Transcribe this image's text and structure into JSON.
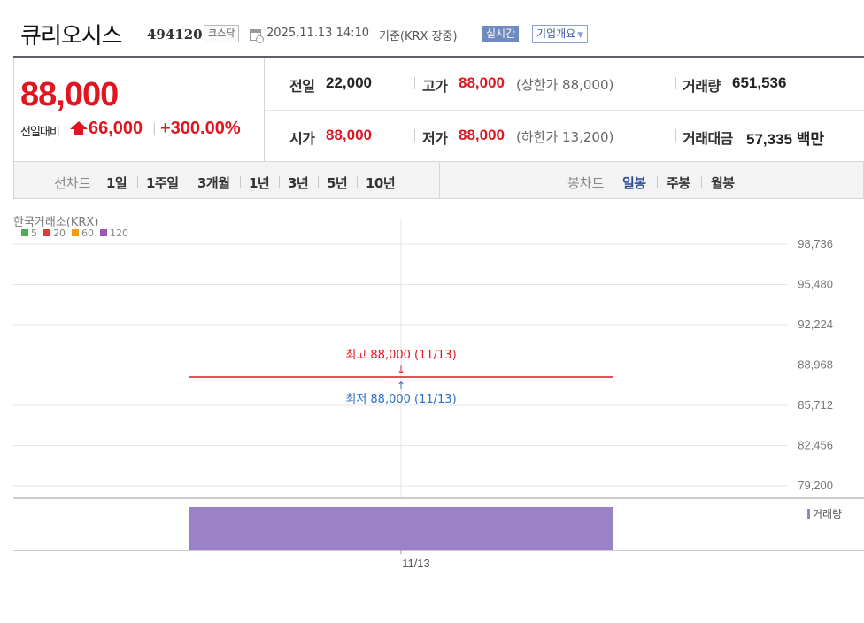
{
  "header": {
    "name": "큐리오시스",
    "code": "494120",
    "market": "코스닥",
    "datetime": "2025.11.13 14:10",
    "basis": "기준(KRX 장중)",
    "realtime_label": "실시간",
    "company_overview": "기업개요"
  },
  "quote": {
    "price": "88,000",
    "change_label": "전일대비",
    "change_value": "66,000",
    "change_pct": "+300.00%",
    "prev_close_label": "전일",
    "prev_close": "22,000",
    "high_label": "고가",
    "high": "88,000",
    "upper_limit": "(상한가 88,000)",
    "volume_label": "거래량",
    "volume": "651,536",
    "open_label": "시가",
    "open": "88,000",
    "low_label": "저가",
    "low": "88,000",
    "lower_limit": "(하한가 13,200)",
    "amount_label": "거래대금",
    "amount": "57,335 백만",
    "colors": {
      "up": "#e0151f",
      "dark": "#222222"
    }
  },
  "tabs": {
    "line_chart_label": "선차트",
    "periods": [
      "1일",
      "1주일",
      "3개월",
      "1년",
      "3년",
      "5년",
      "10년"
    ],
    "candle_chart_label": "봉차트",
    "candles": [
      "일봉",
      "주봉",
      "월봉"
    ],
    "active_candle": "일봉"
  },
  "chart_data": {
    "type": "candlestick",
    "source": "한국거래소(KRX)",
    "legend": [
      {
        "name": "5",
        "color": "#4caf50"
      },
      {
        "name": "20",
        "color": "#e53935"
      },
      {
        "name": "60",
        "color": "#f39c12"
      },
      {
        "name": "120",
        "color": "#9b59b6"
      }
    ],
    "y_ticks": [
      "98,736",
      "95,480",
      "92,224",
      "88,968",
      "85,712",
      "82,456",
      "79,200"
    ],
    "ylim": [
      79200,
      98736
    ],
    "x": [
      "11/13"
    ],
    "candles": [
      {
        "date": "11/13",
        "open": 88000,
        "high": 88000,
        "low": 88000,
        "close": 88000
      }
    ],
    "annotations": {
      "high": "최고 88,000 (11/13)",
      "low": "최저 88,000 (11/13)"
    },
    "volume": {
      "label": "거래량",
      "values": [
        651536
      ],
      "color": "#9b82c6"
    },
    "colors": {
      "up": "#e0151f",
      "high_note": "#e0151f",
      "low_note": "#2a6fc4",
      "grid": "#e6e6e6"
    }
  }
}
